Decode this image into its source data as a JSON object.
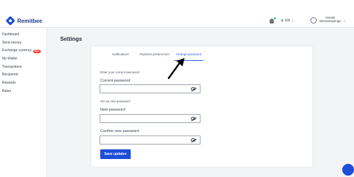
{
  "brand": {
    "name": "Remitbee"
  },
  "header": {
    "language": "EN",
    "user_name_line1": "Vimala",
    "user_name_line2": "Wickramasinga"
  },
  "sidebar": {
    "items": [
      {
        "label": "Dashboard"
      },
      {
        "label": "Send money"
      },
      {
        "label": "Exchange currency",
        "badge": "New"
      },
      {
        "label": "My Wallet"
      },
      {
        "label": "Transactions"
      },
      {
        "label": "Recipients"
      },
      {
        "label": "Rewards"
      },
      {
        "label": "Rates"
      }
    ]
  },
  "main": {
    "title": "Settings",
    "tabs": [
      {
        "label": "Notifications"
      },
      {
        "label": "Payment preferences"
      },
      {
        "label": "Change password"
      }
    ],
    "form": {
      "current_section": "Enter your current password",
      "current_label": "Current password",
      "new_section": "Set up new password",
      "new_label": "New password",
      "confirm_label": "Confirm new password",
      "save_label": "Save updates"
    }
  },
  "colors": {
    "accent": "#1d4ed8",
    "active_tab": "#2563eb",
    "badge": "#ef4444",
    "notification_dot": "#22c55e"
  },
  "icons": [
    "logo-icon",
    "bell-icon",
    "globe-icon",
    "chevron-down-icon",
    "avatar-icon",
    "eye-off-icon",
    "arrow-annotation",
    "chat-icon"
  ]
}
